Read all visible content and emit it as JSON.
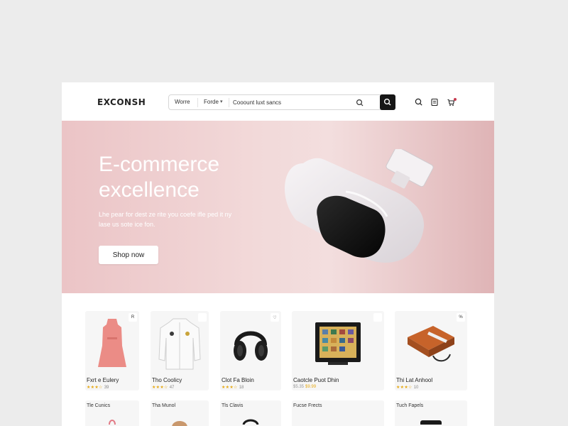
{
  "header": {
    "logo": "EXCONSH",
    "search": {
      "home_label": "Worre",
      "category_label": "Forde",
      "placeholder": "Cooount luxt sancs"
    }
  },
  "hero": {
    "title_line1": "E-commerce",
    "title_line2": "excellence",
    "subtitle": "Lhe pear for dest ze rite you coefe ifle ped it ny lase us sote ice fon.",
    "cta": "Shop now"
  },
  "products": [
    {
      "name": "Fxrt e Eulery",
      "stars": "★★★☆",
      "rating": "39",
      "badge": "R"
    },
    {
      "name": "Tho Coolicy",
      "stars": "★★★☆",
      "rating": "47",
      "badge": ""
    },
    {
      "name": "Clot Fa Bloin",
      "stars": "★★★☆",
      "rating": "18",
      "badge": "♡"
    },
    {
      "name": "Caotcle Puot Dhin",
      "old_price": "$5.35",
      "price": "$9.99",
      "badge": ""
    },
    {
      "name": "Thi Lat Anhool",
      "stars": "★★★☆",
      "rating": "10",
      "badge": "%"
    }
  ],
  "row2": [
    {
      "label": "Tle Cunics"
    },
    {
      "label": "Tha Munol"
    },
    {
      "label": "Tls Clavis"
    },
    {
      "label": "Fucse Frects"
    },
    {
      "label": "Tuch Fapels"
    }
  ],
  "colors": {
    "accent": "#161616",
    "hero_pink": "#ebc4c6",
    "star": "#e6a916"
  }
}
